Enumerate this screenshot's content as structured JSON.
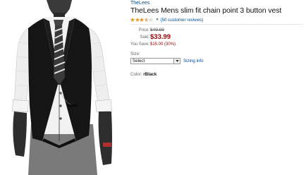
{
  "product": {
    "brand": "TheLees",
    "title": "TheLees Mens slim fit chain point 3 button vest",
    "rating": {
      "stars_filled": 3.5,
      "stars_total": 5,
      "reviews": "(50 customer reviews)"
    },
    "price": {
      "list_label": "Price:",
      "list_value": "$49.99",
      "sale_label": "Sale:",
      "sale_value": "$33.99",
      "save_label": "You Save:",
      "save_value": "$15.00 (30%)"
    },
    "size": {
      "label": "Size:",
      "selected": "Select",
      "sizing_info": "Sizing info"
    },
    "color": {
      "label": "Color:",
      "value": "rBlack"
    }
  },
  "colors": {
    "link": "#004b91",
    "sale_price": "#990000",
    "star": "#f0a020"
  }
}
